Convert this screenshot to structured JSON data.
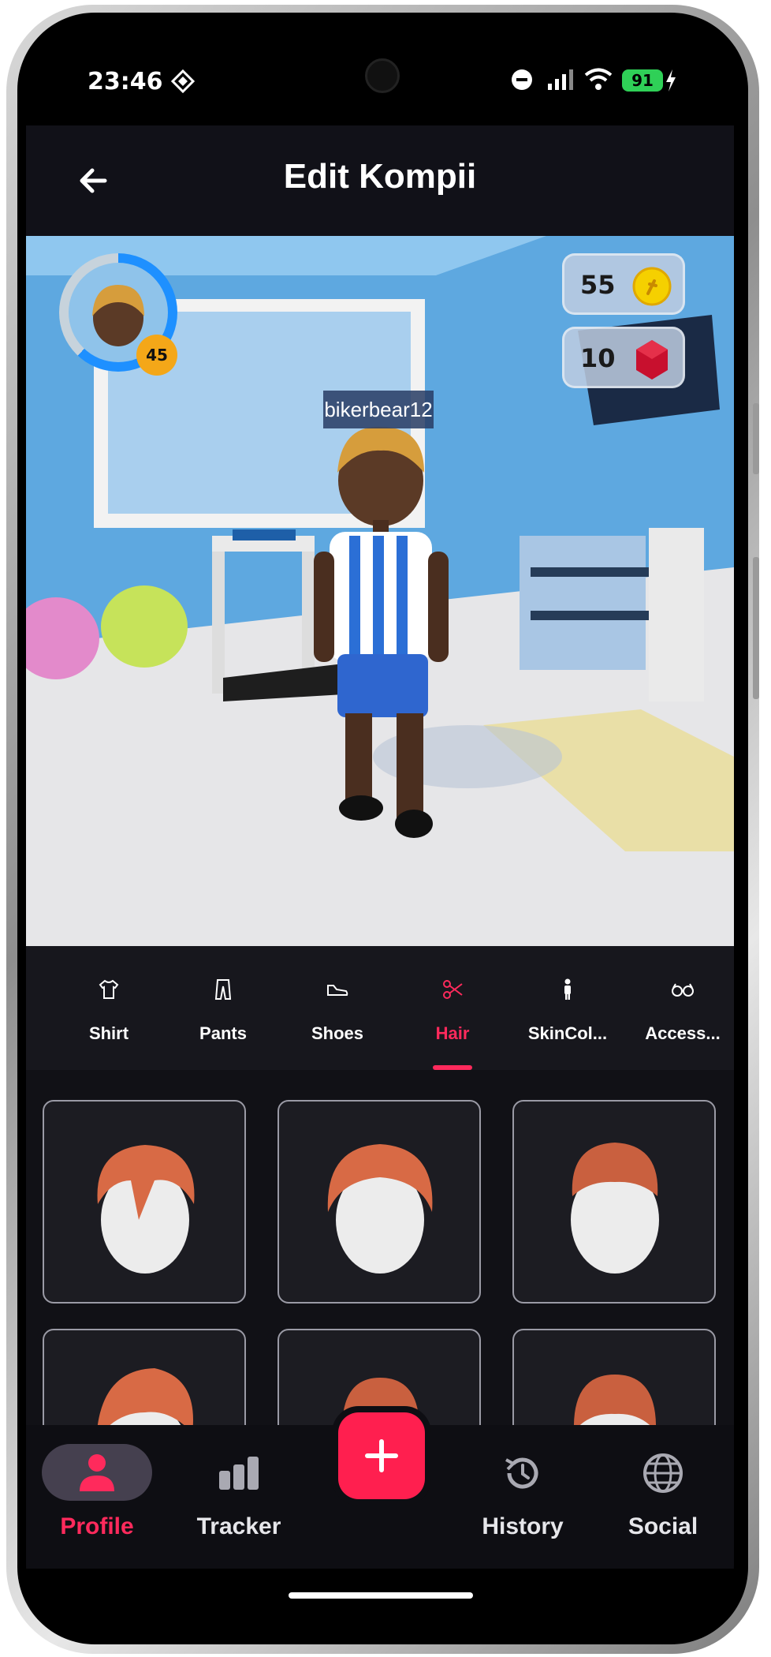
{
  "status_bar": {
    "time": "23:46",
    "battery": "91",
    "icons": [
      "dnd-icon",
      "signal-icon",
      "wifi-icon",
      "battery-icon",
      "charging-icon"
    ]
  },
  "header": {
    "title": "Edit Kompii",
    "back_icon": "back-arrow-icon"
  },
  "scene": {
    "username": "bikerbear12",
    "level": "45",
    "level_progress": 0.62,
    "coins": "55",
    "gems": "10",
    "colors": {
      "ring": "#1e90ff",
      "badge": "#f4a718",
      "coin": "#f5d000",
      "gem": "#c8102e"
    }
  },
  "tabs": [
    {
      "label": "Shirt",
      "icon": "shirt-icon"
    },
    {
      "label": "Pants",
      "icon": "pants-icon"
    },
    {
      "label": "Shoes",
      "icon": "shoe-icon"
    },
    {
      "label": "Hair",
      "icon": "scissors-icon",
      "active": true
    },
    {
      "label": "SkinCol...",
      "icon": "person-icon"
    },
    {
      "label": "Access...",
      "icon": "glasses-icon"
    }
  ],
  "hair_items_count_visible": 6,
  "bottom_nav": [
    {
      "label": "Profile",
      "icon": "person-icon",
      "active": true
    },
    {
      "label": "Tracker",
      "icon": "bar-chart-icon"
    },
    {
      "label": "History",
      "icon": "history-icon"
    },
    {
      "label": "Social",
      "icon": "globe-icon"
    }
  ],
  "fab": {
    "icon": "plus-icon"
  },
  "accent_color": "#ff2a5c"
}
